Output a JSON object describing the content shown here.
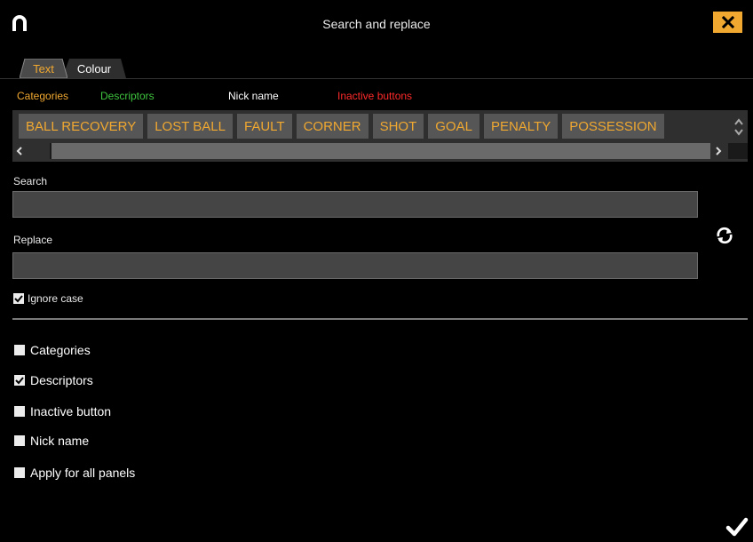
{
  "window": {
    "title": "Search and replace",
    "close_icon": "close-icon",
    "logo_icon": "app-logo-icon"
  },
  "tabs": [
    {
      "label": "Text",
      "active": true,
      "color": "#f0a830"
    },
    {
      "label": "Colour",
      "active": false,
      "color": "#ffffff"
    }
  ],
  "legend": {
    "categories": "Categories",
    "descriptors": "Descriptors",
    "nick_name": "Nick name",
    "inactive_buttons": "Inactive buttons"
  },
  "button_strip": {
    "buttons": [
      "BALL RECOVERY",
      "LOST BALL",
      "FAULT",
      "CORNER",
      "SHOT",
      "GOAL",
      "PENALTY",
      "POSSESSION"
    ]
  },
  "search": {
    "label": "Search",
    "value": ""
  },
  "replace": {
    "label": "Replace",
    "value": ""
  },
  "ignore_case": {
    "label": "Ignore case",
    "checked": true
  },
  "options": [
    {
      "label": "Categories",
      "checked": false
    },
    {
      "label": "Descriptors",
      "checked": true
    },
    {
      "label": "Inactive button",
      "checked": false
    },
    {
      "label": "Nick name",
      "checked": false
    },
    {
      "label": "Apply for all panels",
      "checked": false
    }
  ],
  "colors": {
    "accent": "#f0a830",
    "descriptor": "#3ec43e",
    "inactive": "#ff2a2a",
    "background": "#000000"
  }
}
